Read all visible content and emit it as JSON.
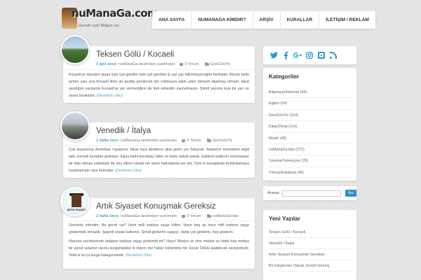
{
  "site": {
    "logo_title": "nuManaGa.com",
    "logo_tagline": "Aşiretin yok! Bloğun var."
  },
  "nav": {
    "items": [
      "ANA SAYFA",
      "NUMANAGA KİMDIR?",
      "ARŞİV",
      "KURALLAR",
      "İLETİŞİM / REKLAM"
    ]
  },
  "posts": [
    {
      "title": "Teksen Gölü / Kocaeli",
      "time": "3 gün önce",
      "by": "nuManaGa tarafından yazılmıştır.",
      "comments": "0 Yorum",
      "category": "Gez/Gör/Ye",
      "excerpt": "Kocaeli'ye atandım ataalı öyle çok gezdim öyle çok gördüm ki yaz yaz bitiremeyeceğim herhalde. Birçok farklı şehrin yanı sıra Kocaeli ilinin de gezilip görülecek her noktasına adım adım dersem abartmış olmam; fakat yazdığım yazılarda Kocaeli'ye yer vermediğimi de fark etmedim zannetmeyin. Şimdi yazıma kısa bir yarı ve anılar bırakalım.",
      "more": "(Devamını Oku)"
    },
    {
      "title": "Venedik / İtalya",
      "time": "1 hafta önce",
      "by": "nuManaGa tarafından yazılmıştır.",
      "comments": "0 Yorum",
      "category": "Gez/Gör/Ye",
      "excerpt": "Çok duyarsınız Amerikan rüyalarını; fakat rüya dendince akla gelen yer İtalya'dır. Babamın memleketi değil tabi, kısmeti buradan gelmiyor. İtalya tarihi korumayı bilen ve bunu sokak sokak, kaldırım kaldırım önemseyen bir ülke olması sebebiyle bir düş ülkesi olarak her darm hafızalarda yer alır. Öyle ki savaşlarda bombalamaya kıyamamıştır nice komutan.",
      "more": "(Devamını Oku)",
      "thumb_text": ""
    },
    {
      "title": "Artık Siyaset Konuşmak Gereksiz",
      "time": "2 hafta önce",
      "by": "nuManaGa tarafından yazılmıştır.",
      "comments": "0 Yorum",
      "category": "nuManaGa'dan",
      "thumb_text": "ARTIK SİYASET",
      "excerpt_1": "Gereksiz efendim. Ne gerek var? Hem milli iradeye saygı lütfen. Hayır beş ay önce milli iradeye saygı göstermek olmazdı. Şaşırdı orada halkımız. Şimdi gösterim saygıyı, daha çok gösterin, hep gösterin.",
      "excerpt_2": "Hazıran seçimlerinde değişen tabloya saygı gösterildi mi? Hayır! Medya ve yine medya ve hatta hep medya bir güzel selamet oyunu tezgahladılar ki inanın her haber bültenimiz bir Oscar Ödülü alabilecek seviyedeydi. Tabii ki en iyi kurgu kategorisinde.",
      "more": "(Devamını Oku)"
    }
  ],
  "sidebar": {
    "social": [
      "twitter-icon",
      "facebook-icon",
      "google-plus-icon",
      "instagram-icon",
      "box-icon",
      "rss-icon"
    ],
    "categories_title": "Kategoriler",
    "categories": [
      "Bilgisayar/İnternet (64)",
      "Eğitim (54)",
      "Gez/Gör/Ye (104)",
      "Kitap/Dergi (114)",
      "Müzik (49)",
      "nuManaGa'dan (372)",
      "Sinema/Televizyon (78)",
      "Türkçe/Edebiyat (46)"
    ],
    "search_label": "Arama:",
    "search_value": "",
    "search_button": "Ara",
    "recent_title": "Yeni Yazılar",
    "recent": [
      "Teksen Gölü / Kocaeli",
      "Venedik / İtalya",
      "Artık Siyaset Konuşmak Gereksiz",
      "Bir Eleştirmen Olarak Semih Gümüş"
    ]
  },
  "colors": {
    "accent": "#4aa0c9",
    "social": "#1e9ad0",
    "button": "#2e8ed0"
  }
}
